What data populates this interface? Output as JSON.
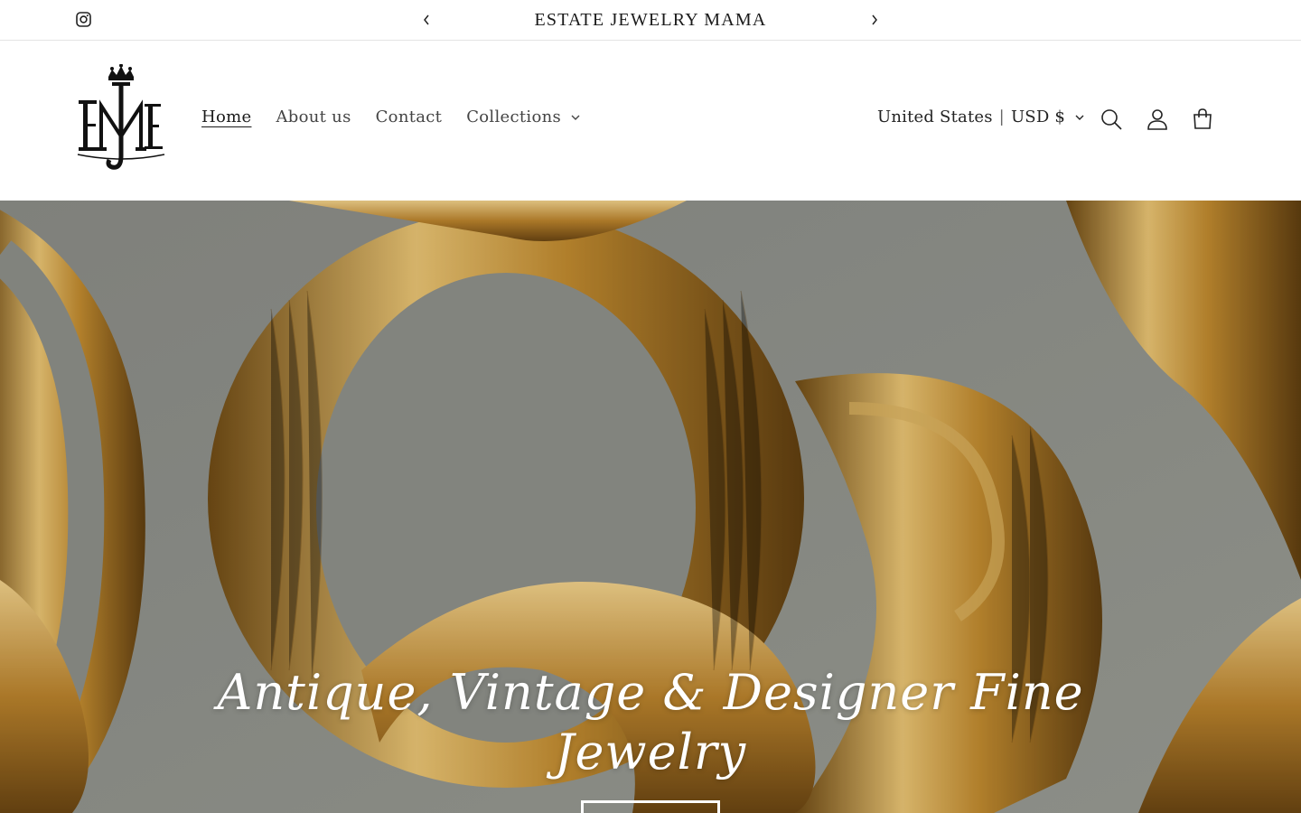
{
  "announcement": {
    "message": "ESTATE JEWELRY MAMA",
    "social_icon": "instagram-icon",
    "prev_icon": "chevron-left-icon",
    "next_icon": "chevron-right-icon"
  },
  "header": {
    "logo_icon": "monogram-crown-logo",
    "nav": [
      {
        "label": "Home",
        "active": true
      },
      {
        "label": "About us"
      },
      {
        "label": "Contact"
      },
      {
        "label": "Collections",
        "has_dropdown": true
      }
    ],
    "locale": {
      "country": "United States",
      "separator": "|",
      "currency": "USD $"
    },
    "icons": [
      "search-icon",
      "account-icon",
      "cart-icon"
    ]
  },
  "hero": {
    "heading": "Antique, Vintage & Designer Fine Jewelry",
    "image": "gold curb chain links close-up",
    "colors": {
      "gold": "#c99a3a",
      "background": "#8d8f88"
    }
  }
}
